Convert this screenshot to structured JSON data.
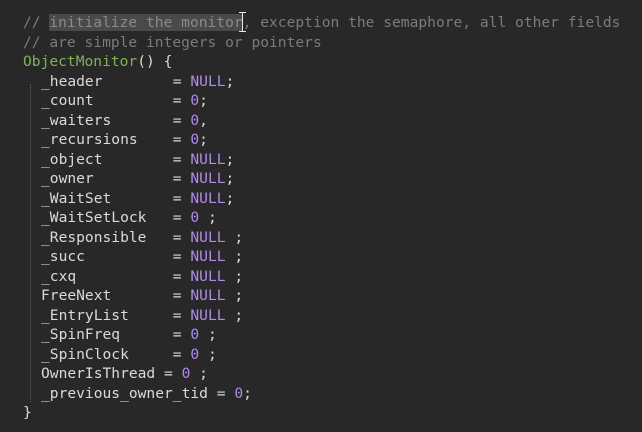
{
  "comment": {
    "prefix": "// ",
    "highlighted": "initialize the monitor",
    "rest": ", exception the semaphore, all other fields",
    "line2": "// are simple integers or pointers"
  },
  "constructor": {
    "name": "ObjectMonitor",
    "sig": "() {",
    "close": "}"
  },
  "fields": [
    {
      "name": "_header        ",
      "eq": "= ",
      "value": "NULL",
      "value_type": "null",
      "end": ";"
    },
    {
      "name": "_count         ",
      "eq": "= ",
      "value": "0",
      "value_type": "num",
      "end": ";"
    },
    {
      "name": "_waiters       ",
      "eq": "= ",
      "value": "0",
      "value_type": "num",
      "end": ","
    },
    {
      "name": "_recursions    ",
      "eq": "= ",
      "value": "0",
      "value_type": "num",
      "end": ";"
    },
    {
      "name": "_object        ",
      "eq": "= ",
      "value": "NULL",
      "value_type": "null",
      "end": ";"
    },
    {
      "name": "_owner         ",
      "eq": "= ",
      "value": "NULL",
      "value_type": "null",
      "end": ";"
    },
    {
      "name": "_WaitSet       ",
      "eq": "= ",
      "value": "NULL",
      "value_type": "null",
      "end": ";"
    },
    {
      "name": "_WaitSetLock   ",
      "eq": "= ",
      "value": "0",
      "value_type": "num",
      "end": " ;"
    },
    {
      "name": "_Responsible   ",
      "eq": "= ",
      "value": "NULL",
      "value_type": "null",
      "end": " ;"
    },
    {
      "name": "_succ          ",
      "eq": "= ",
      "value": "NULL",
      "value_type": "null",
      "end": " ;"
    },
    {
      "name": "_cxq           ",
      "eq": "= ",
      "value": "NULL",
      "value_type": "null",
      "end": " ;"
    },
    {
      "name": "FreeNext       ",
      "eq": "= ",
      "value": "NULL",
      "value_type": "null",
      "end": " ;"
    },
    {
      "name": "_EntryList     ",
      "eq": "= ",
      "value": "NULL",
      "value_type": "null",
      "end": " ;"
    },
    {
      "name": "_SpinFreq      ",
      "eq": "= ",
      "value": "0",
      "value_type": "num",
      "end": " ;"
    },
    {
      "name": "_SpinClock     ",
      "eq": "= ",
      "value": "0",
      "value_type": "num",
      "end": " ;"
    },
    {
      "name": "OwnerIsThread ",
      "eq": "= ",
      "value": "0",
      "value_type": "num",
      "end": " ;"
    },
    {
      "name": "_previous_owner_tid ",
      "eq": "= ",
      "value": "0",
      "value_type": "num",
      "end": ";"
    }
  ]
}
